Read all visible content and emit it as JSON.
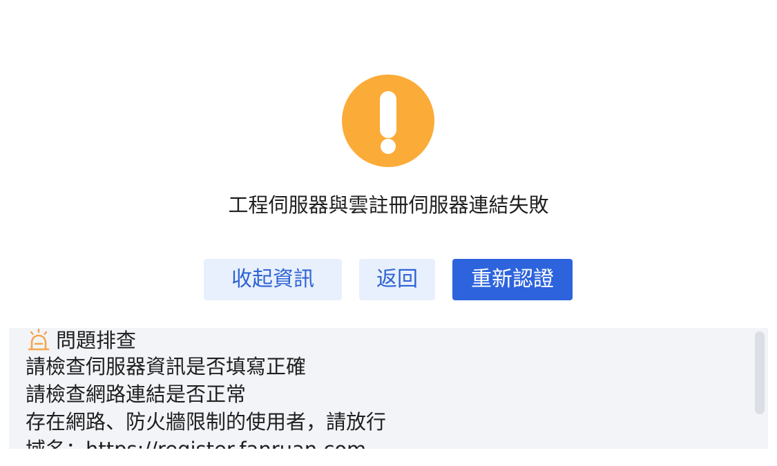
{
  "status": {
    "icon": "exclamation-icon",
    "title": "工程伺服器與雲註冊伺服器連結失敗",
    "accent_color": "#fbab38"
  },
  "actions": {
    "collapse_label": "收起資訊",
    "back_label": "返回",
    "reauth_label": "重新認證",
    "primary_color": "#2d63dd",
    "secondary_bg": "#e8f0fd"
  },
  "troubleshoot": {
    "icon": "alarm-light-icon",
    "header": "問題排查",
    "lines": [
      "請檢查伺服器資訊是否填寫正確",
      "請檢查網路連結是否正常",
      "存在網路、防火牆限制的使用者，請放行",
      "域名：https://register.fanruan.com"
    ]
  }
}
